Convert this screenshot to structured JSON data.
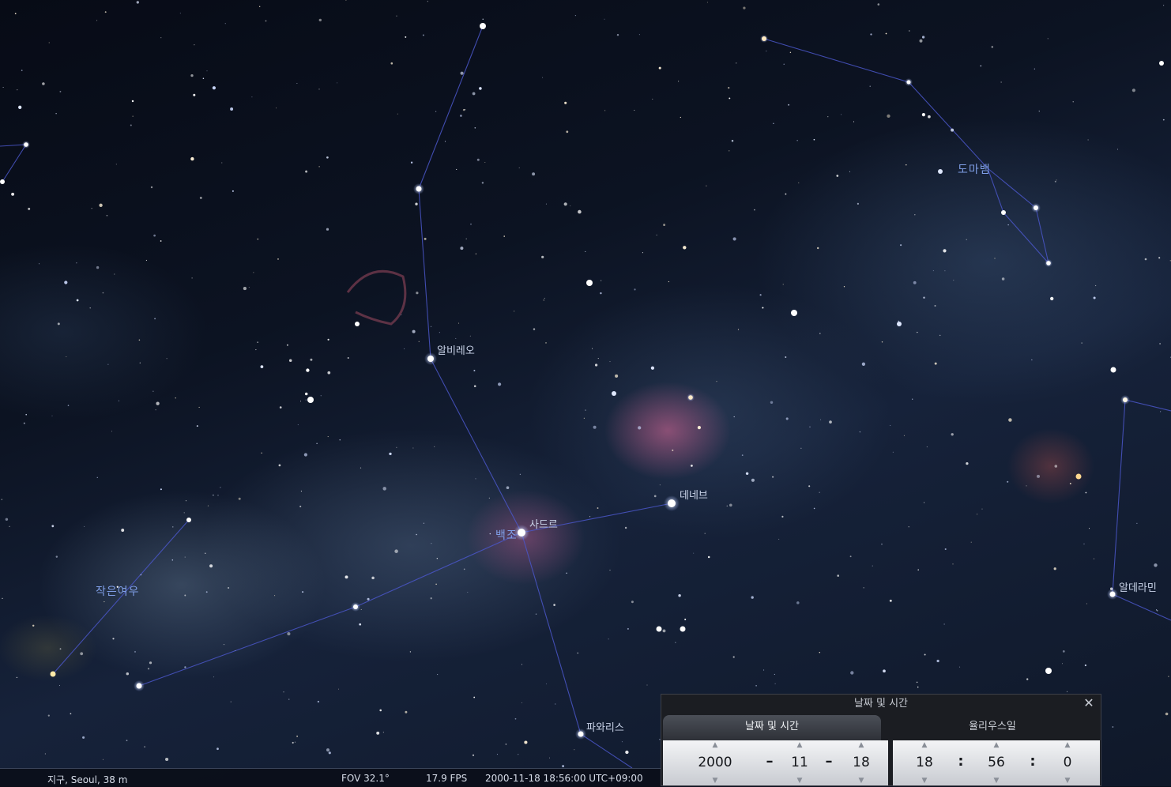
{
  "sky": {
    "star_labels": {
      "albireo": "알비레오",
      "sadr": "사드르",
      "deneb": "데네브",
      "fawaris": "파와리스",
      "alderamin": "알데라민"
    },
    "constellation_labels": {
      "cygnus": "백조",
      "lacerta": "도마뱀",
      "vulpecula": "작은여우"
    }
  },
  "status_bar": {
    "location": "지구, Seoul, 38 m",
    "fov": "FOV 32.1°",
    "fps": "17.9 FPS",
    "datetime": "2000-11-18 18:56:00 UTC+09:00"
  },
  "date_time_dialog": {
    "title": "날짜 및 시간",
    "close_icon": "close-icon",
    "tabs": [
      "날짜 및 시간",
      "율리우스일"
    ],
    "active_tab": 0,
    "date": {
      "year": "2000",
      "month": "11",
      "day": "18",
      "separator": "–"
    },
    "time": {
      "hour": "18",
      "minute": "56",
      "second": "0",
      "separator": ":"
    }
  },
  "colors": {
    "constellation_line": "#4a56c8",
    "constellation_label": "#7f9ee6",
    "star_label": "#c9d3e8",
    "dialog_bg": "#1b1d22"
  }
}
